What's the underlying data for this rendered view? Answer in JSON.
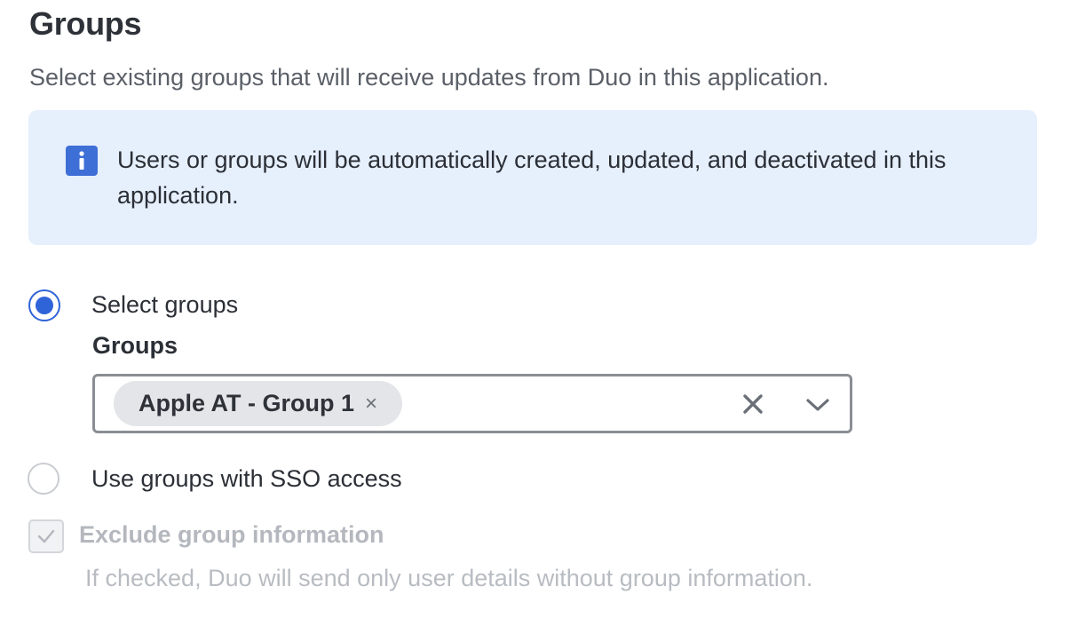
{
  "section": {
    "title": "Groups",
    "subtitle": "Select existing groups that will receive updates from Duo in this application."
  },
  "info_banner": {
    "icon": "info-icon",
    "text": "Users or groups will be automatically created, updated, and deactivated in this application."
  },
  "group_source": {
    "selected": "select_groups",
    "options": [
      {
        "id": "select_groups",
        "label": "Select groups"
      },
      {
        "id": "sso_access",
        "label": "Use groups with SSO access"
      }
    ]
  },
  "groups_field": {
    "label": "Groups",
    "selected_chips": [
      {
        "label": "Apple AT - Group 1",
        "remove_glyph": "×"
      }
    ]
  },
  "exclude_group_info": {
    "label": "Exclude group information",
    "help": "If checked, Duo will send only user details without group information.",
    "checked": true,
    "disabled": true
  },
  "colors": {
    "accent": "#2f63d8",
    "banner_bg": "#e6effc",
    "chip_bg": "#e3e5e8",
    "disabled_text": "#b4b8be"
  }
}
